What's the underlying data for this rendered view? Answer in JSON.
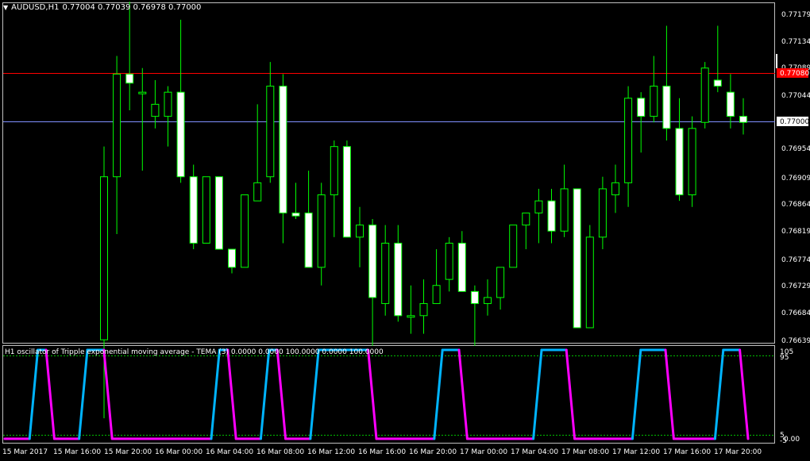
{
  "header": {
    "dropdown_icon": "triangle-down-icon",
    "symbol": "AUDUSD,H1",
    "ohlc": "0.77004 0.77039 0.76978 0.77000"
  },
  "indicator": {
    "title": "H1 oscillator of Tripple exponential moving average - TEMA (3) 0.0000 0.0000 100.0000 0.0000 100.0000"
  },
  "colors": {
    "background": "#000000",
    "frame": "#c0c0c0",
    "bull_candle": "#00ff00",
    "bear_body": "#ffffff",
    "hline_red": "#ff0000",
    "hline_blue": "#8090ff",
    "osc_up": "#00b4ff",
    "osc_down": "#ff00ff",
    "osc_level": "#00c000"
  },
  "price_axis": {
    "labels": [
      "0.77179",
      "0.77134",
      "0.77089",
      "0.77044",
      "0.77000",
      "0.76954",
      "0.76909",
      "0.76864",
      "0.76819",
      "0.76774",
      "0.76729",
      "0.76684",
      "0.76639"
    ],
    "red_line_label": "0.77080",
    "current_label": "0.77000"
  },
  "osc_axis": {
    "labels": [
      "105",
      "95",
      "5",
      "-5",
      "0.00"
    ]
  },
  "time_axis": {
    "labels": [
      "15 Mar 2017",
      "15 Mar 16:00",
      "15 Mar 20:00",
      "16 Mar 00:00",
      "16 Mar 04:00",
      "16 Mar 08:00",
      "16 Mar 12:00",
      "16 Mar 16:00",
      "16 Mar 20:00",
      "17 Mar 00:00",
      "17 Mar 04:00",
      "17 Mar 08:00",
      "17 Mar 12:00",
      "17 Mar 16:00",
      "17 Mar 20:00"
    ]
  },
  "chart_data": {
    "type": "candlestick",
    "symbol": "AUDUSD",
    "timeframe": "H1",
    "y_range": [
      0.7663,
      0.772
    ],
    "hlines": [
      0.7708,
      0.77
    ],
    "candles": [
      {
        "o": 0.7664,
        "h": 0.7696,
        "l": 0.7651,
        "c": 0.7691
      },
      {
        "o": 0.7691,
        "h": 0.7711,
        "l": 0.76815,
        "c": 0.7708
      },
      {
        "o": 0.7708,
        "h": 0.772,
        "l": 0.7702,
        "c": 0.77065
      },
      {
        "o": 0.7705,
        "h": 0.7709,
        "l": 0.7692,
        "c": 0.7705
      },
      {
        "o": 0.7701,
        "h": 0.7707,
        "l": 0.7699,
        "c": 0.7703
      },
      {
        "o": 0.7701,
        "h": 0.7706,
        "l": 0.7696,
        "c": 0.7705
      },
      {
        "o": 0.7705,
        "h": 0.7717,
        "l": 0.769,
        "c": 0.7691
      },
      {
        "o": 0.7691,
        "h": 0.7693,
        "l": 0.7679,
        "c": 0.768
      },
      {
        "o": 0.768,
        "h": 0.7691,
        "l": 0.768,
        "c": 0.7691
      },
      {
        "o": 0.7691,
        "h": 0.7691,
        "l": 0.7679,
        "c": 0.7679
      },
      {
        "o": 0.7679,
        "h": 0.7679,
        "l": 0.7675,
        "c": 0.7676
      },
      {
        "o": 0.7676,
        "h": 0.7688,
        "l": 0.7676,
        "c": 0.7688
      },
      {
        "o": 0.7687,
        "h": 0.7703,
        "l": 0.7687,
        "c": 0.769
      },
      {
        "o": 0.7691,
        "h": 0.771,
        "l": 0.769,
        "c": 0.7706
      },
      {
        "o": 0.7706,
        "h": 0.7708,
        "l": 0.768,
        "c": 0.7685
      },
      {
        "o": 0.7685,
        "h": 0.769,
        "l": 0.7684,
        "c": 0.76845
      },
      {
        "o": 0.7685,
        "h": 0.7692,
        "l": 0.7676,
        "c": 0.7676
      },
      {
        "o": 0.7676,
        "h": 0.769,
        "l": 0.7673,
        "c": 0.7688
      },
      {
        "o": 0.7688,
        "h": 0.7697,
        "l": 0.7681,
        "c": 0.7696
      },
      {
        "o": 0.7696,
        "h": 0.7697,
        "l": 0.7681,
        "c": 0.7681
      },
      {
        "o": 0.7681,
        "h": 0.7686,
        "l": 0.7676,
        "c": 0.7683
      },
      {
        "o": 0.7683,
        "h": 0.7684,
        "l": 0.7663,
        "c": 0.7671
      },
      {
        "o": 0.767,
        "h": 0.7683,
        "l": 0.7668,
        "c": 0.768
      },
      {
        "o": 0.768,
        "h": 0.7683,
        "l": 0.7667,
        "c": 0.7668
      },
      {
        "o": 0.7668,
        "h": 0.7673,
        "l": 0.7665,
        "c": 0.7668
      },
      {
        "o": 0.7668,
        "h": 0.7674,
        "l": 0.7665,
        "c": 0.767
      },
      {
        "o": 0.767,
        "h": 0.7679,
        "l": 0.767,
        "c": 0.7673
      },
      {
        "o": 0.7674,
        "h": 0.7681,
        "l": 0.7672,
        "c": 0.768
      },
      {
        "o": 0.768,
        "h": 0.7682,
        "l": 0.7672,
        "c": 0.7672
      },
      {
        "o": 0.7672,
        "h": 0.7673,
        "l": 0.7663,
        "c": 0.767
      },
      {
        "o": 0.767,
        "h": 0.7674,
        "l": 0.7668,
        "c": 0.7671
      },
      {
        "o": 0.7671,
        "h": 0.7676,
        "l": 0.7669,
        "c": 0.7676
      },
      {
        "o": 0.7676,
        "h": 0.7683,
        "l": 0.7676,
        "c": 0.7683
      },
      {
        "o": 0.7683,
        "h": 0.7685,
        "l": 0.7679,
        "c": 0.7685
      },
      {
        "o": 0.7685,
        "h": 0.7689,
        "l": 0.768,
        "c": 0.7687
      },
      {
        "o": 0.7687,
        "h": 0.7689,
        "l": 0.768,
        "c": 0.7682
      },
      {
        "o": 0.7682,
        "h": 0.7693,
        "l": 0.7681,
        "c": 0.7689
      },
      {
        "o": 0.7689,
        "h": 0.7689,
        "l": 0.7666,
        "c": 0.7666
      },
      {
        "o": 0.7666,
        "h": 0.7683,
        "l": 0.7666,
        "c": 0.7681
      },
      {
        "o": 0.7681,
        "h": 0.7691,
        "l": 0.7679,
        "c": 0.7689
      },
      {
        "o": 0.7688,
        "h": 0.7693,
        "l": 0.7685,
        "c": 0.769
      },
      {
        "o": 0.769,
        "h": 0.7706,
        "l": 0.7686,
        "c": 0.7704
      },
      {
        "o": 0.7704,
        "h": 0.7705,
        "l": 0.7695,
        "c": 0.7701
      },
      {
        "o": 0.7701,
        "h": 0.7711,
        "l": 0.77,
        "c": 0.7706
      },
      {
        "o": 0.7706,
        "h": 0.7716,
        "l": 0.7697,
        "c": 0.7699
      },
      {
        "o": 0.7699,
        "h": 0.7704,
        "l": 0.7687,
        "c": 0.7688
      },
      {
        "o": 0.7688,
        "h": 0.7701,
        "l": 0.7686,
        "c": 0.7699
      },
      {
        "o": 0.77,
        "h": 0.771,
        "l": 0.7699,
        "c": 0.7709
      },
      {
        "o": 0.7707,
        "h": 0.7716,
        "l": 0.7705,
        "c": 0.7706
      },
      {
        "o": 0.7705,
        "h": 0.7708,
        "l": 0.7699,
        "c": 0.7701
      },
      {
        "o": 0.7701,
        "h": 0.7704,
        "l": 0.7698,
        "c": 0.77
      }
    ],
    "oscillator": {
      "name": "TEMA (3)",
      "range": [
        0,
        100
      ],
      "levels": [
        95,
        5
      ],
      "x_start": 0,
      "values": [
        0,
        0,
        0,
        0,
        100,
        100,
        0,
        0,
        0,
        0,
        100,
        100,
        100,
        0,
        0,
        0,
        0,
        0,
        0,
        0,
        0,
        0,
        0,
        0,
        0,
        0,
        100,
        100,
        0,
        0,
        0,
        0,
        100,
        100,
        0,
        0,
        0,
        0,
        100,
        100,
        100,
        100,
        100,
        100,
        100,
        0,
        0,
        0,
        0,
        0,
        0,
        0,
        0,
        100,
        100,
        100,
        0,
        0,
        0,
        0,
        0,
        0,
        0,
        0,
        0,
        100,
        100,
        100,
        100,
        0,
        0,
        0,
        0,
        0,
        0,
        0,
        0,
        100,
        100,
        100,
        100,
        0,
        0,
        0,
        0,
        0,
        0,
        100,
        100,
        100,
        0
      ],
      "note_colors": "rising segments blue, falling/flat segments magenta"
    }
  }
}
